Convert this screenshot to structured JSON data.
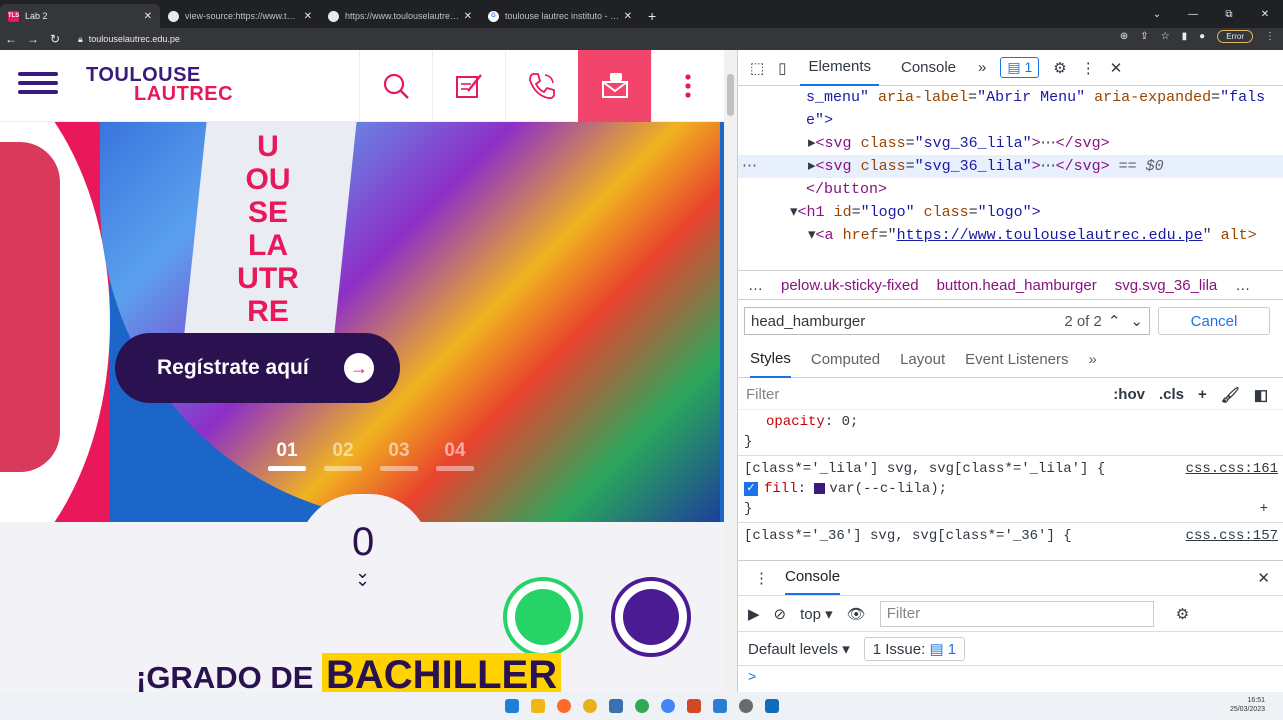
{
  "tabs": [
    {
      "title": "Lab 2",
      "icon": "toulouse-favicon",
      "active": true
    },
    {
      "title": "view-source:https://www.toulous",
      "icon": "globe-icon"
    },
    {
      "title": "https://www.toulouselautrec.edu",
      "icon": "globe-icon"
    },
    {
      "title": "toulouse lautrec instituto - Busc",
      "icon": "google-icon"
    }
  ],
  "tab_close": "✕",
  "new_tab": "+",
  "address": {
    "url": "toulouselautrec.edu.pe",
    "error_label": "Error"
  },
  "site": {
    "logo_line1": "TOULOUSE",
    "logo_line2": "LAUTREC",
    "register_button": "Regístrate aquí",
    "slides": [
      "01",
      "02",
      "03",
      "04"
    ],
    "scroll_indicator": "0",
    "headline_plain": "¡GRADO DE",
    "headline_highlight": "BACHILLER",
    "colors": {
      "purple": "#3b1a7e",
      "pink": "#e8185a",
      "yellow": "#ffd200",
      "whatsapp": "#25d366"
    }
  },
  "devtools": {
    "tabs": [
      "Elements",
      "Console"
    ],
    "more": "»",
    "badge": "1",
    "dom_lines": {
      "l1a": "s_menu\"",
      "l1b": "aria-label",
      "l1c": "\"Abrir Menu\"",
      "l1d": "aria-expanded",
      "l1e": "\"fals",
      "l2": "e\">",
      "l3_tag": "<svg",
      "l3_attr": "class",
      "l3_val": "\"svg_36_lila\"",
      "l3_end": "</svg>",
      "l4_tag": "<svg",
      "l4_attr": "class",
      "l4_val": "\"svg_36_lila\"",
      "l4_end": "</svg>",
      "l4_sel": "== $0",
      "l5": "</button>",
      "l6_tag": "<h1",
      "l6_attr1": "id",
      "l6_val1": "\"logo\"",
      "l6_attr2": "class",
      "l6_val2": "\"logo\">",
      "l7_tag": "<a",
      "l7_attr": "href",
      "l7_val": "https://www.toulouselautrec.edu.pe",
      "l7_end": "alt>"
    },
    "breadcrumbs": [
      "…",
      "pelow.uk-sticky-fixed",
      "button.head_hamburger",
      "svg.svg_36_lila",
      "…"
    ],
    "search": {
      "value": "head_hamburger",
      "count": "2 of 2",
      "cancel": "Cancel"
    },
    "style_tabs": [
      "Styles",
      "Computed",
      "Layout",
      "Event Listeners"
    ],
    "filter_placeholder": "Filter",
    "filter_tools": [
      ":hov",
      ".cls",
      "+"
    ],
    "css": {
      "opacity_prop": "opacity",
      "opacity_val": "0;",
      "brace_close": "}",
      "rule1": "[class*='_lila'] svg, svg[class*='_lila'] {",
      "rule1_src": "css.css:161",
      "fill_prop": "fill",
      "fill_val": "var(--c-lila);",
      "rule2": "[class*='_36'] svg, svg[class*='_36'] {",
      "rule2_src": "css.css:157"
    },
    "console": {
      "title": "Console",
      "context": "top",
      "filter_placeholder": "Filter",
      "levels": "Default levels",
      "issues_label": "1 Issue:",
      "issues_count": "1",
      "prompt": ">"
    }
  },
  "taskbar": {
    "time": "16:51",
    "date": "25/03/2023"
  }
}
